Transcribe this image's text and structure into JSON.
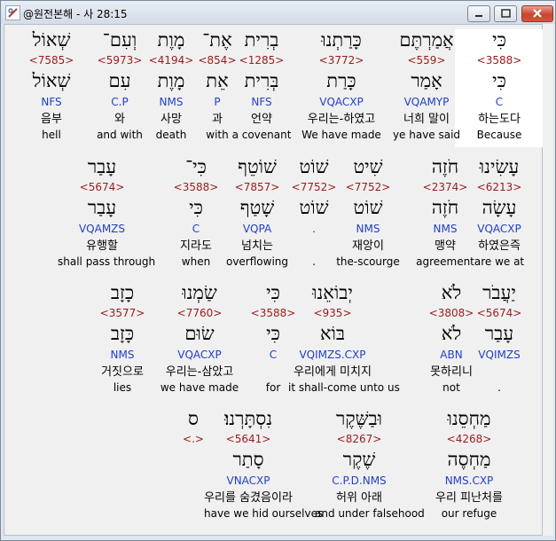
{
  "window": {
    "title": "@원전본해 - 사 28:15",
    "buttons": {
      "minimize": "minimize",
      "maximize": "maximize",
      "close": "close"
    }
  },
  "rows": [
    {
      "words": [
        {
          "heb": "כִּי",
          "num": "<3588>",
          "root": "כִּי",
          "parse": "C",
          "kor": "하는도다",
          "eng": "Because",
          "highlight": true
        },
        {
          "heb": "אֲמַרְתֶּם",
          "num": "<559>",
          "root": "אָמַר",
          "parse": "VQAMYP",
          "kor": "너희 말이",
          "eng": "ye have said"
        },
        {
          "heb": "כָּרַתְנוּ",
          "num": "<3772>",
          "root": "כָּרַת",
          "parse": "VQACXP",
          "kor": "우리는-하였고",
          "eng": "We have made"
        },
        {
          "heb": "בְרִית",
          "num": "<1285>",
          "root": "בְּרִית",
          "parse": "NFS",
          "kor": "언약",
          "eng": "a covenant"
        },
        {
          "heb": "אֶת־",
          "num": "<854>",
          "root": "אֵת",
          "parse": "P",
          "kor": "과",
          "eng": "with"
        },
        {
          "heb": "מָוֶת",
          "num": "<4194>",
          "root": "מָוֶת",
          "parse": "NMS",
          "kor": "사망",
          "eng": "death"
        },
        {
          "heb": "וְעִם־",
          "num": "<5973>",
          "root": "עִם",
          "parse": "C.P",
          "kor": "와",
          "eng": "and with"
        },
        {
          "heb": "שְׁאוֹל",
          "num": "<7585>",
          "root": "שְׁאוֹל",
          "parse": "NFS",
          "kor": "음부",
          "eng": "hell"
        }
      ]
    },
    {
      "words": [
        {
          "heb": "עָשִׂינוּ",
          "num": "<6213>",
          "root": "עָשָׂה",
          "parse": "VQACXP",
          "kor": "하였은즉",
          "eng": "are we at"
        },
        {
          "heb": "חֹזֶה",
          "num": "<2374>",
          "root": "חֹזֶה",
          "parse": "NMS",
          "kor": "맹약",
          "eng": "agreement"
        },
        {
          "heb": "שִׁיט",
          "num": "<7752>",
          "root": "שׁוֹט",
          "parse": "NMS",
          "kor": "재앙이",
          "eng": "the-scourge"
        },
        {
          "heb": "שׁוֹט",
          "num": "<7752>",
          "root": "שׁוֹט",
          "parse": ".",
          "kor": "",
          "eng": "."
        },
        {
          "heb": "שׁוֹטֵף",
          "num": "<7857>",
          "root": "שָׁטַף",
          "parse": "VQPA",
          "kor": "넘치는",
          "eng": "overflowing"
        },
        {
          "heb": "כִּי־",
          "num": "<3588>",
          "root": "כִּי",
          "parse": "C",
          "kor": "지라도",
          "eng": "when"
        },
        {
          "heb": "עָבַר",
          "num": "<5674>",
          "root": "עָבַר",
          "parse": "VQAMZS",
          "kor": "유행할",
          "eng": "shall pass through"
        }
      ]
    },
    {
      "words": [
        {
          "heb": "יַעֲבֹר",
          "num": "<5674>",
          "root": "עָבַר",
          "parse": "VQIMZS",
          "kor": "",
          "eng": "."
        },
        {
          "heb": "לֹא",
          "num": "<3808>",
          "root": "לֹא",
          "parse": "ABN",
          "kor": "못하리니",
          "eng": "not"
        },
        {
          "heb": "יְבוֹאֵנוּ",
          "num": "<935>",
          "root": "בּוֹא",
          "parse": "VQIMZS.CXP",
          "kor": "우리에게 미치지",
          "eng": "it shall-come unto us"
        },
        {
          "heb": "כִּי",
          "num": "<3588>",
          "root": "כִּי",
          "parse": "C",
          "kor": "",
          "eng": "for"
        },
        {
          "heb": "שַׂמְנוּ",
          "num": "<7760>",
          "root": "שׂוּם",
          "parse": "VQACXP",
          "kor": "우리는-삼았고",
          "eng": "we have made"
        },
        {
          "heb": "כָזָב",
          "num": "<3577>",
          "root": "כָּזָב",
          "parse": "NMS",
          "kor": "거짓으로",
          "eng": "lies"
        }
      ]
    },
    {
      "words": [
        {
          "heb": "מַחְסֵנוּ",
          "num": "<4268>",
          "root": "מַחְסֶה",
          "parse": "NMS.CXP",
          "kor": "우리 피난처를",
          "eng": "our refuge"
        },
        {
          "heb": "וּבַשֶּׁקֶר",
          "num": "<8267>",
          "root": "שֶׁקֶר",
          "parse": "C.P.D.NMS",
          "kor": "허위 아래",
          "eng": "and under falsehood"
        },
        {
          "heb": "נִסְתָּרְנוּ׃",
          "num": "<5641>",
          "root": "סָתַר",
          "parse": "VNACXP",
          "kor": "우리를 숨겼음이라",
          "eng": "have we hid ourselves"
        },
        {
          "heb": "ס",
          "num": "<.>",
          "root": "",
          "parse": "",
          "kor": "",
          "eng": ""
        }
      ]
    }
  ]
}
